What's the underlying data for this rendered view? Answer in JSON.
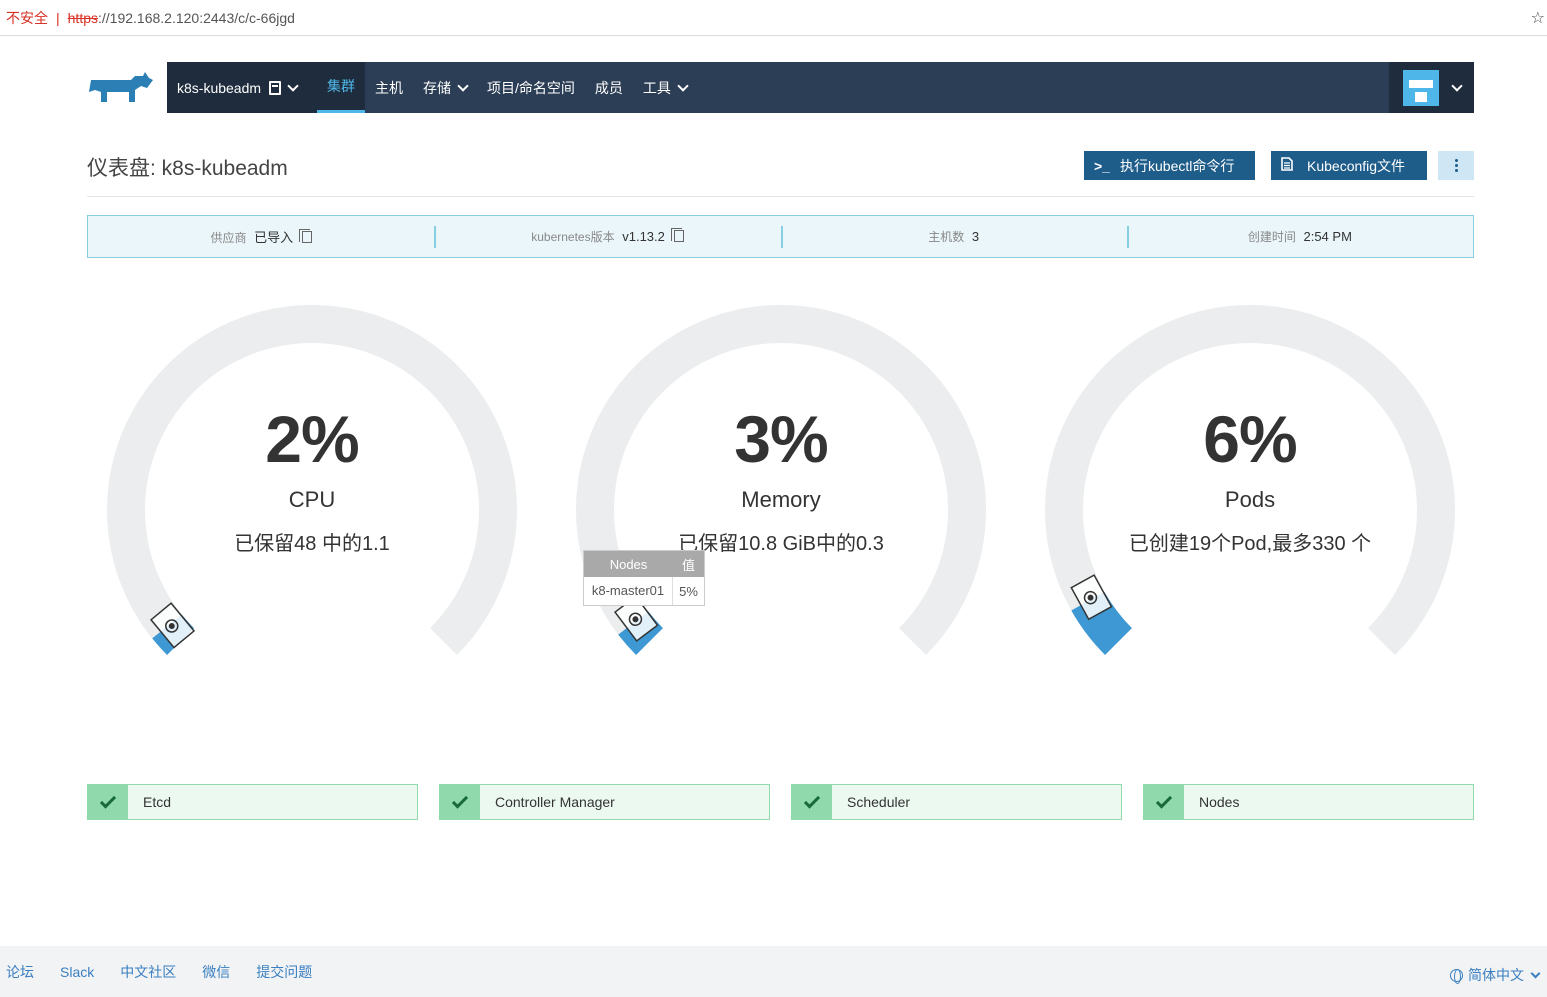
{
  "browser": {
    "insecure_label": "不安全",
    "separator": "|",
    "url_scheme": "https",
    "url_rest": "://192.168.2.120:2443/c/c-66jgd"
  },
  "nav": {
    "cluster_name": "k8s-kubeadm",
    "items": [
      {
        "label": "集群",
        "active": true
      },
      {
        "label": "主机",
        "active": false
      },
      {
        "label": "存储",
        "dropdown": true
      },
      {
        "label": "项目/命名空间",
        "active": false
      },
      {
        "label": "成员",
        "active": false
      },
      {
        "label": "工具",
        "dropdown": true
      }
    ]
  },
  "header": {
    "title": "仪表盘: k8s-kubeadm",
    "kubectl_button": "执行kubectl命令行",
    "kubectl_icon": ">_",
    "kubeconfig_button": "Kubeconfig文件"
  },
  "info": {
    "provider_label": "供应商",
    "provider_value": "已导入",
    "k8s_label": "kubernetes版本",
    "k8s_value": "v1.13.2",
    "hosts_label": "主机数",
    "hosts_value": "3",
    "created_label": "创建时间",
    "created_value": "2:54 PM"
  },
  "gauges": [
    {
      "percent_text": "2%",
      "percent": 2,
      "label": "CPU",
      "desc": "已保留48 中的1.1",
      "reserved_fraction": 0.023
    },
    {
      "percent_text": "3%",
      "percent": 3,
      "label": "Memory",
      "desc": "已保留10.8 GiB中的0.3",
      "reserved_fraction": 0.028
    },
    {
      "percent_text": "6%",
      "percent": 6,
      "label": "Pods",
      "desc": "已创建19个Pod,最多330 个",
      "reserved_fraction": 0.058
    }
  ],
  "tooltip": {
    "col_nodes": "Nodes",
    "col_value": "值",
    "row_node": "k8-master01",
    "row_value": "5%"
  },
  "components": [
    {
      "label": "Etcd"
    },
    {
      "label": "Controller Manager"
    },
    {
      "label": "Scheduler"
    },
    {
      "label": "Nodes"
    }
  ],
  "footer": {
    "links": [
      "论坛",
      "Slack",
      "中文社区",
      "微信",
      "提交问题"
    ],
    "language": "简体中文"
  },
  "colors": {
    "nav_bg": "#2c3e55",
    "accent": "#4eb6e8",
    "gauge_track": "#ebedee",
    "gauge_fill": "#3d98d3",
    "status_ok": "#8fd9ad"
  }
}
